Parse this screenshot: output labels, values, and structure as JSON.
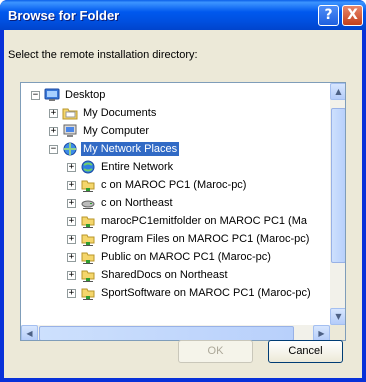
{
  "window": {
    "title": "Browse for Folder",
    "help_label": "?",
    "close_label": "X"
  },
  "instruction": "Select the remote installation directory:",
  "tree": {
    "items": [
      {
        "label": "Desktop",
        "expander": "−",
        "icon": "desktop-icon",
        "indent": 0,
        "selected": false
      },
      {
        "label": "My Documents",
        "expander": "+",
        "icon": "folder-icon",
        "indent": 1,
        "selected": false
      },
      {
        "label": "My Computer",
        "expander": "+",
        "icon": "computer-icon",
        "indent": 1,
        "selected": false
      },
      {
        "label": "My Network Places",
        "expander": "−",
        "icon": "network-places-icon",
        "indent": 1,
        "selected": true
      },
      {
        "label": "Entire Network",
        "expander": "+",
        "icon": "globe-icon",
        "indent": 2,
        "selected": false
      },
      {
        "label": "c on MAROC PC1 (Maroc-pc)",
        "expander": "+",
        "icon": "network-share-icon",
        "indent": 2,
        "selected": false
      },
      {
        "label": "c on Northeast",
        "expander": "+",
        "icon": "network-drive-icon",
        "indent": 2,
        "selected": false
      },
      {
        "label": "marocPC1emitfolder on MAROC PC1 (Ma",
        "expander": "+",
        "icon": "network-share-icon",
        "indent": 2,
        "selected": false
      },
      {
        "label": "Program Files on MAROC PC1 (Maroc-pc)",
        "expander": "+",
        "icon": "network-share-icon",
        "indent": 2,
        "selected": false
      },
      {
        "label": "Public on MAROC PC1 (Maroc-pc)",
        "expander": "+",
        "icon": "network-share-icon",
        "indent": 2,
        "selected": false
      },
      {
        "label": "SharedDocs on Northeast",
        "expander": "+",
        "icon": "network-share-icon",
        "indent": 2,
        "selected": false
      },
      {
        "label": "SportSoftware on MAROC PC1 (Maroc-pc)",
        "expander": "+",
        "icon": "network-share-icon",
        "indent": 2,
        "selected": false
      }
    ]
  },
  "buttons": {
    "ok_label": "OK",
    "cancel_label": "Cancel"
  },
  "colors": {
    "selection": "#316ac5",
    "titlebar": "#0058ee",
    "dialog_bg": "#ece9d8"
  }
}
